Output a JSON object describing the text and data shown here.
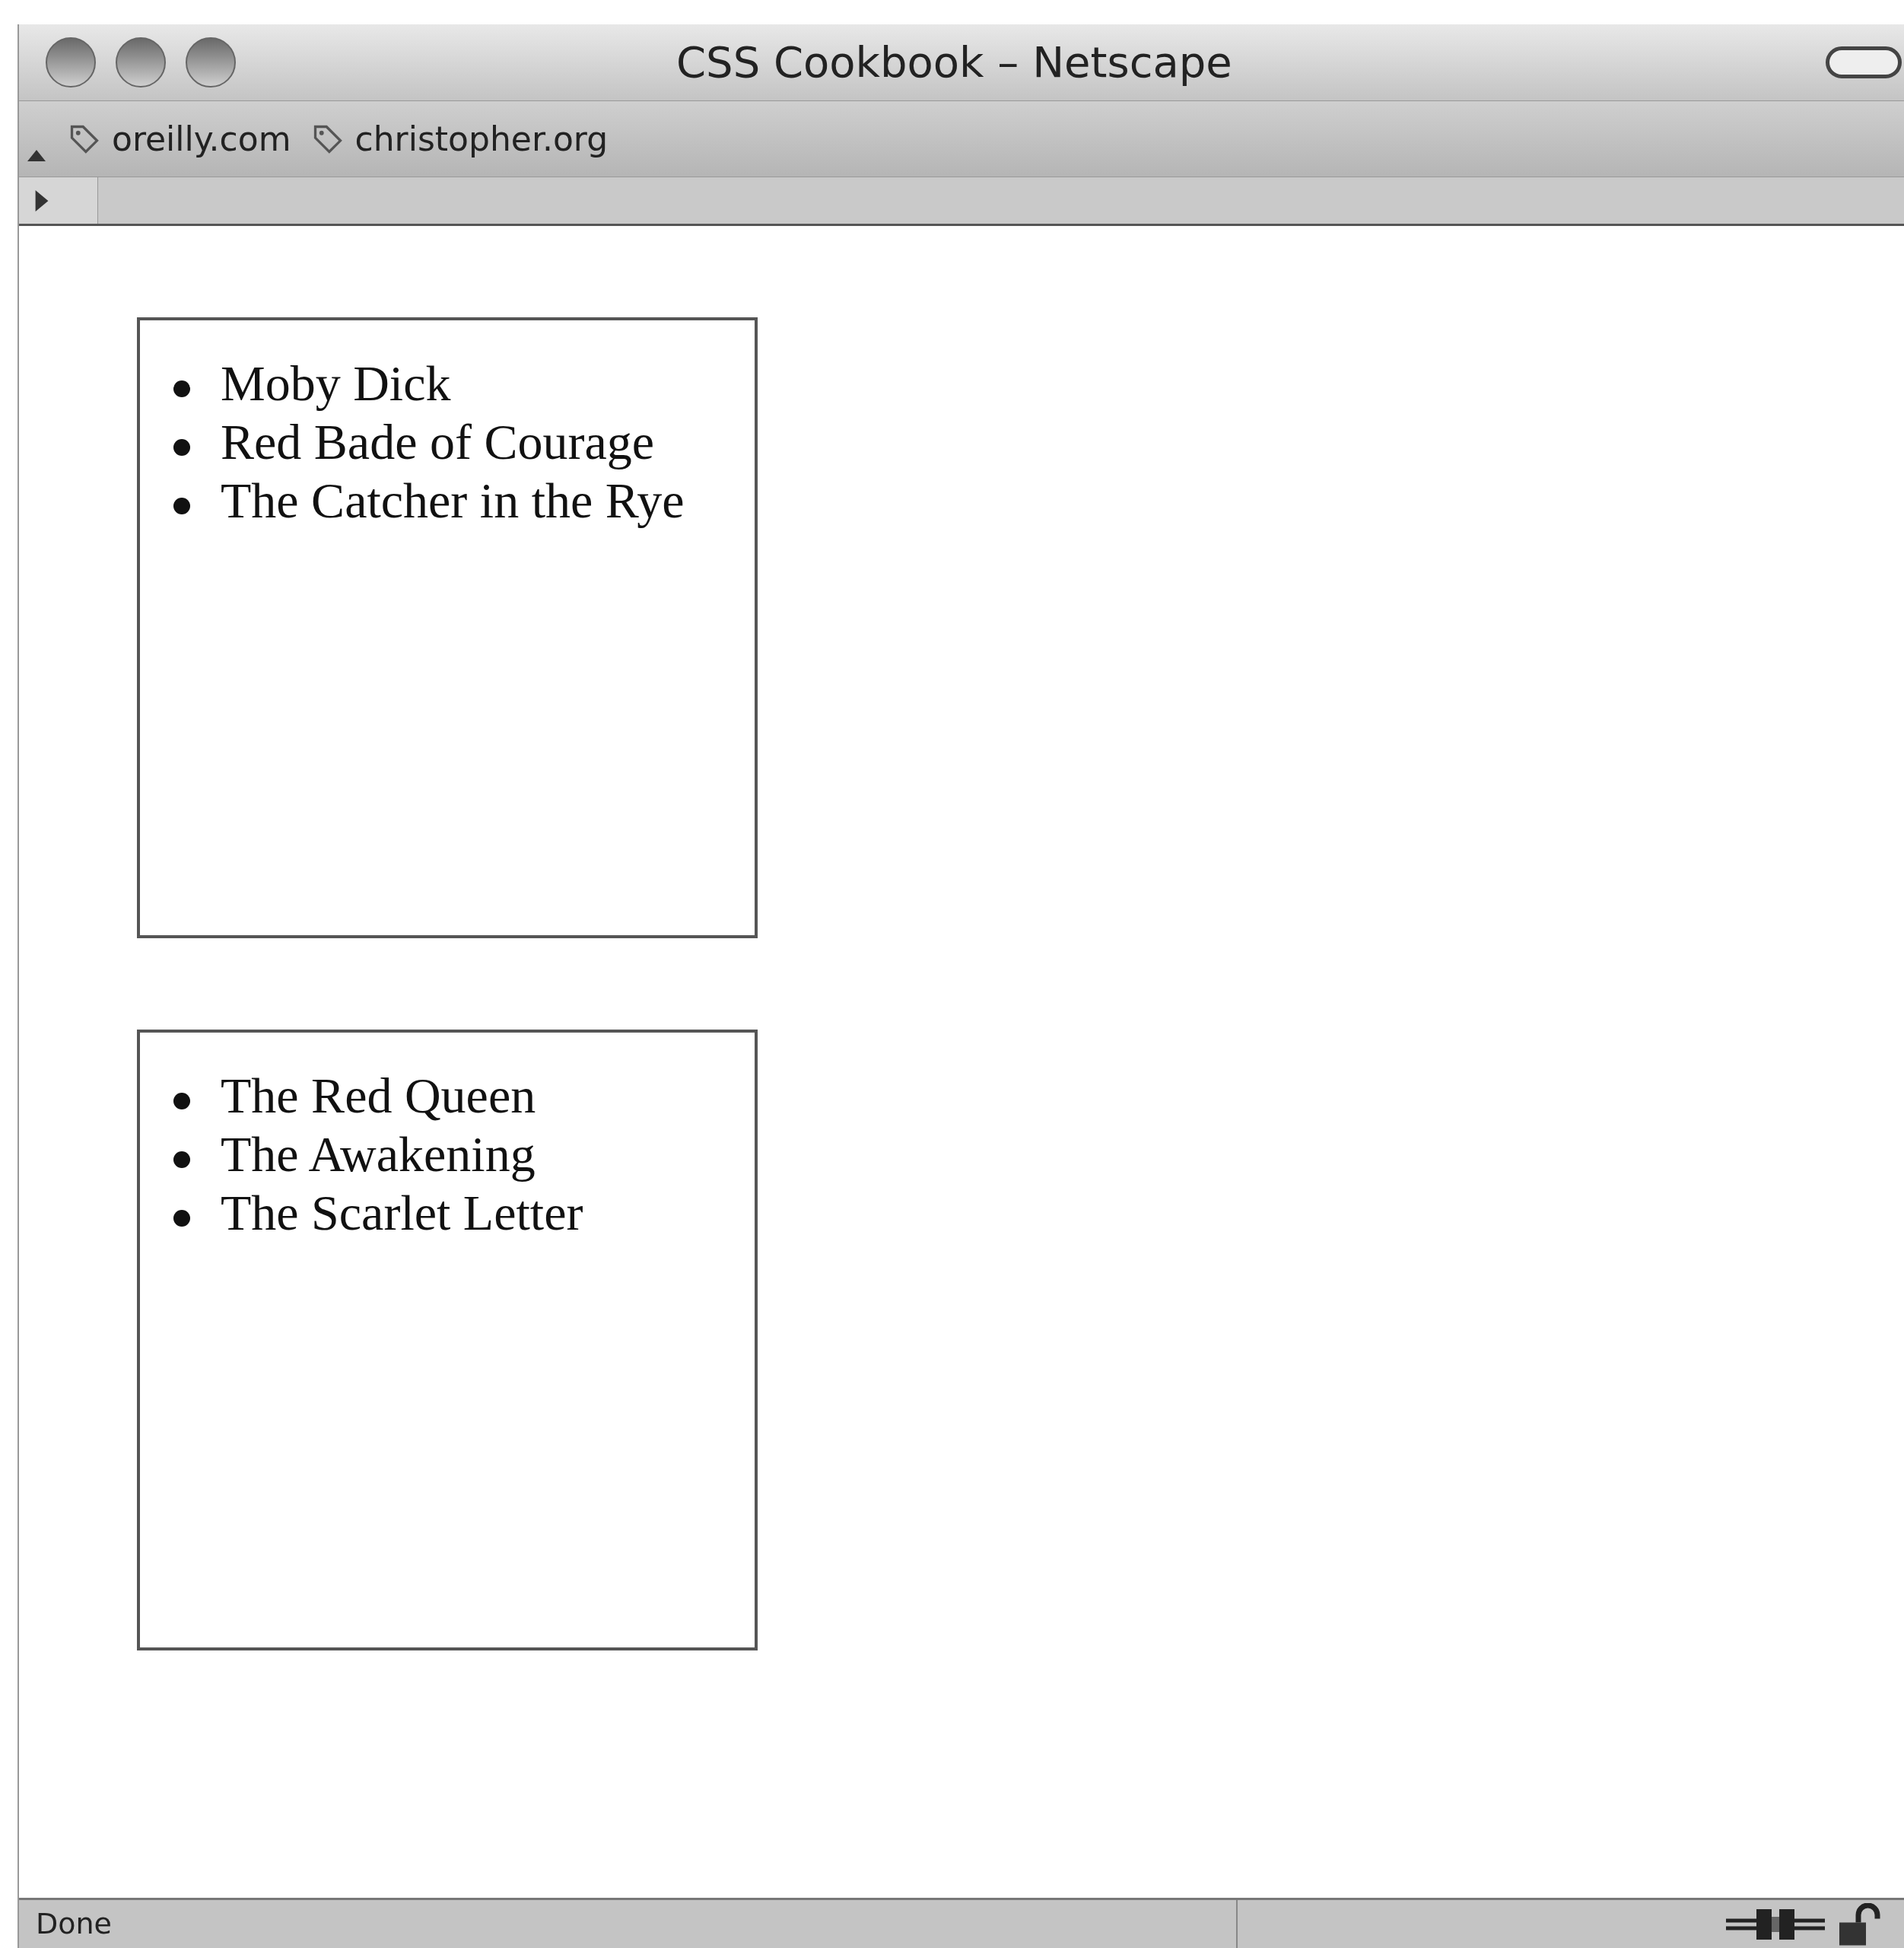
{
  "window": {
    "title": "CSS Cookbook – Netscape"
  },
  "bookmarks": [
    {
      "label": "oreilly.com"
    },
    {
      "label": "christopher.org"
    }
  ],
  "lists": [
    {
      "items": [
        "Moby Dick",
        "Red Bade of Courage",
        "The Catcher in the Rye"
      ]
    },
    {
      "items": [
        "The Red Queen",
        "The Awakening",
        "The Scarlet Letter"
      ]
    }
  ],
  "status_bar": {
    "text": "Done"
  }
}
